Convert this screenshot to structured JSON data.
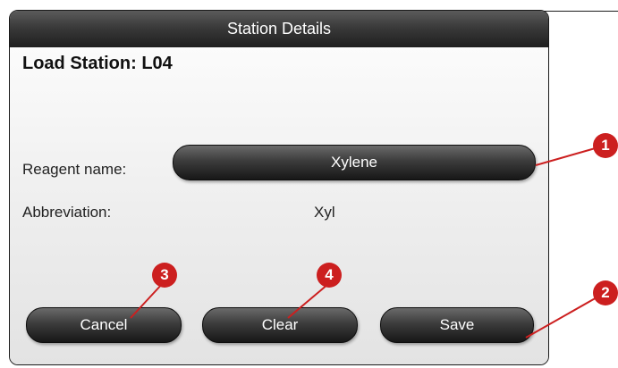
{
  "dialog": {
    "title": "Station Details",
    "station_title": "Load Station: L04",
    "reagent_name_label": "Reagent name:",
    "reagent_name_value": "Xylene",
    "abbreviation_label": "Abbreviation:",
    "abbreviation_value": "Xyl"
  },
  "buttons": {
    "cancel": "Cancel",
    "clear": "Clear",
    "save": "Save"
  },
  "callouts": [
    "1",
    "2",
    "3",
    "4"
  ],
  "colors": {
    "callout": "#cc1f1f",
    "button_dark": "#1f1f1f"
  }
}
